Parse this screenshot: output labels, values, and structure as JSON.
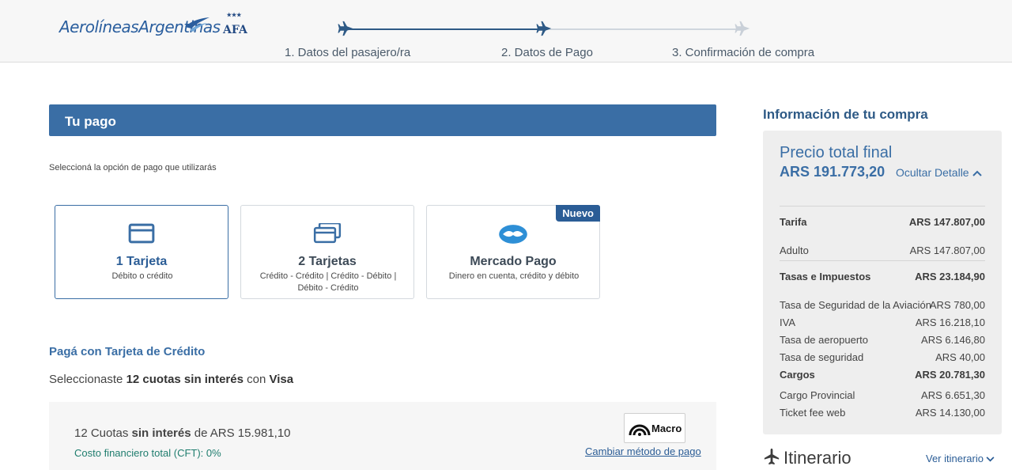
{
  "header": {
    "logo_text": "AerolíneasArgentinas",
    "afa_text": "AFA",
    "steps": [
      {
        "label": "1. Datos del pasajero/ra"
      },
      {
        "label": "2. Datos de Pago"
      },
      {
        "label": "3. Confirmación de compra"
      }
    ]
  },
  "payment": {
    "section_title": "Tu pago",
    "hint": "Seleccioná la opción de pago que utilizarás",
    "options": [
      {
        "title": "1 Tarjeta",
        "subtitle": "Débito o crédito"
      },
      {
        "title": "2 Tarjetas",
        "subtitle": "Crédito - Crédito | Crédito - Débito | Débito - Crédito"
      },
      {
        "title": "Mercado Pago",
        "subtitle": "Dinero en cuenta, crédito y débito",
        "badge": "Nuevo"
      }
    ],
    "pay_title": "Pagá con Tarjeta de Crédito",
    "selected_prefix": "Seleccionaste ",
    "selected_plan": "12 cuotas sin interés",
    "selected_mid": " con ",
    "selected_card": "Visa",
    "cuotas_prefix": "12 Cuotas ",
    "cuotas_bold": "sin interés",
    "cuotas_suffix": " de ARS 15.981,10",
    "cft": "Costo financiero total (CFT): 0%",
    "bank_name": "Macro",
    "change_method": "Cambiar método de pago"
  },
  "summary": {
    "title": "Información de tu compra",
    "price_title": "Precio total final",
    "price_total": "ARS 191.773,20",
    "hide_detail": "Ocultar Detalle",
    "rows": [
      {
        "label": "Tarifa",
        "value": "ARS 147.807,00"
      },
      {
        "label": "Adulto",
        "value": "ARS 147.807,00"
      },
      {
        "label": "Tasas e Impuestos",
        "value": "ARS 23.184,90"
      },
      {
        "label": "Tasa de Seguridad de la Aviación",
        "value": "ARS 780,00"
      },
      {
        "label": "IVA",
        "value": "ARS 16.218,10"
      },
      {
        "label": "Tasa de aeropuerto",
        "value": "ARS 6.146,80"
      },
      {
        "label": "Tasa de seguridad",
        "value": "ARS 40,00"
      },
      {
        "label": "Cargos",
        "value": "ARS 20.781,30"
      },
      {
        "label": "Cargo Provincial",
        "value": "ARS 6.651,30"
      },
      {
        "label": "Ticket fee web",
        "value": "ARS 14.130,00"
      }
    ]
  },
  "itinerary": {
    "title": "Itinerario",
    "link": "Ver itinerario"
  },
  "colors": {
    "brand_blue": "#3a6ea5",
    "cft_green": "#1f7d6e"
  }
}
